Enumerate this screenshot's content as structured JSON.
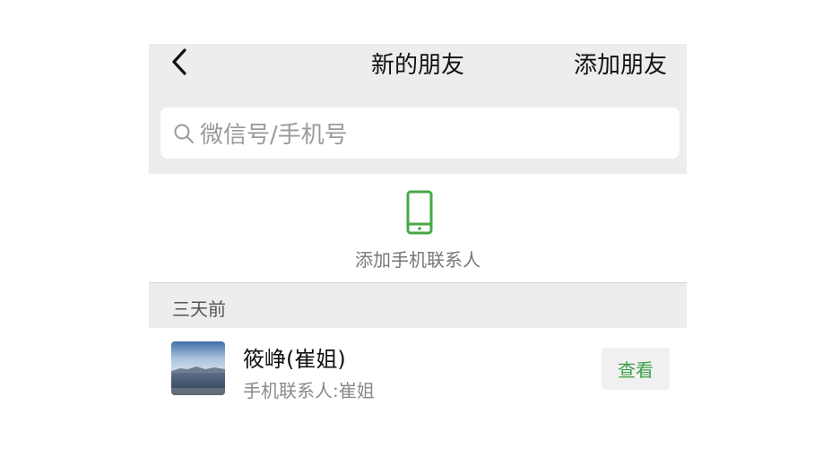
{
  "header": {
    "back_icon": "chevron-left-icon",
    "title": "新的朋友",
    "add_friend_label": "添加朋友"
  },
  "search": {
    "icon": "search-icon",
    "placeholder": "微信号/手机号"
  },
  "contacts_entry": {
    "icon": "mobile-phone-icon",
    "icon_color": "#46a845",
    "label": "添加手机联系人"
  },
  "section": {
    "label": "三天前"
  },
  "friend_requests": [
    {
      "name": "筱峥(崔姐)",
      "description": "手机联系人:崔姐",
      "action_label": "查看"
    }
  ],
  "colors": {
    "header_bg": "#ededed",
    "accent_green": "#3fa14a"
  }
}
